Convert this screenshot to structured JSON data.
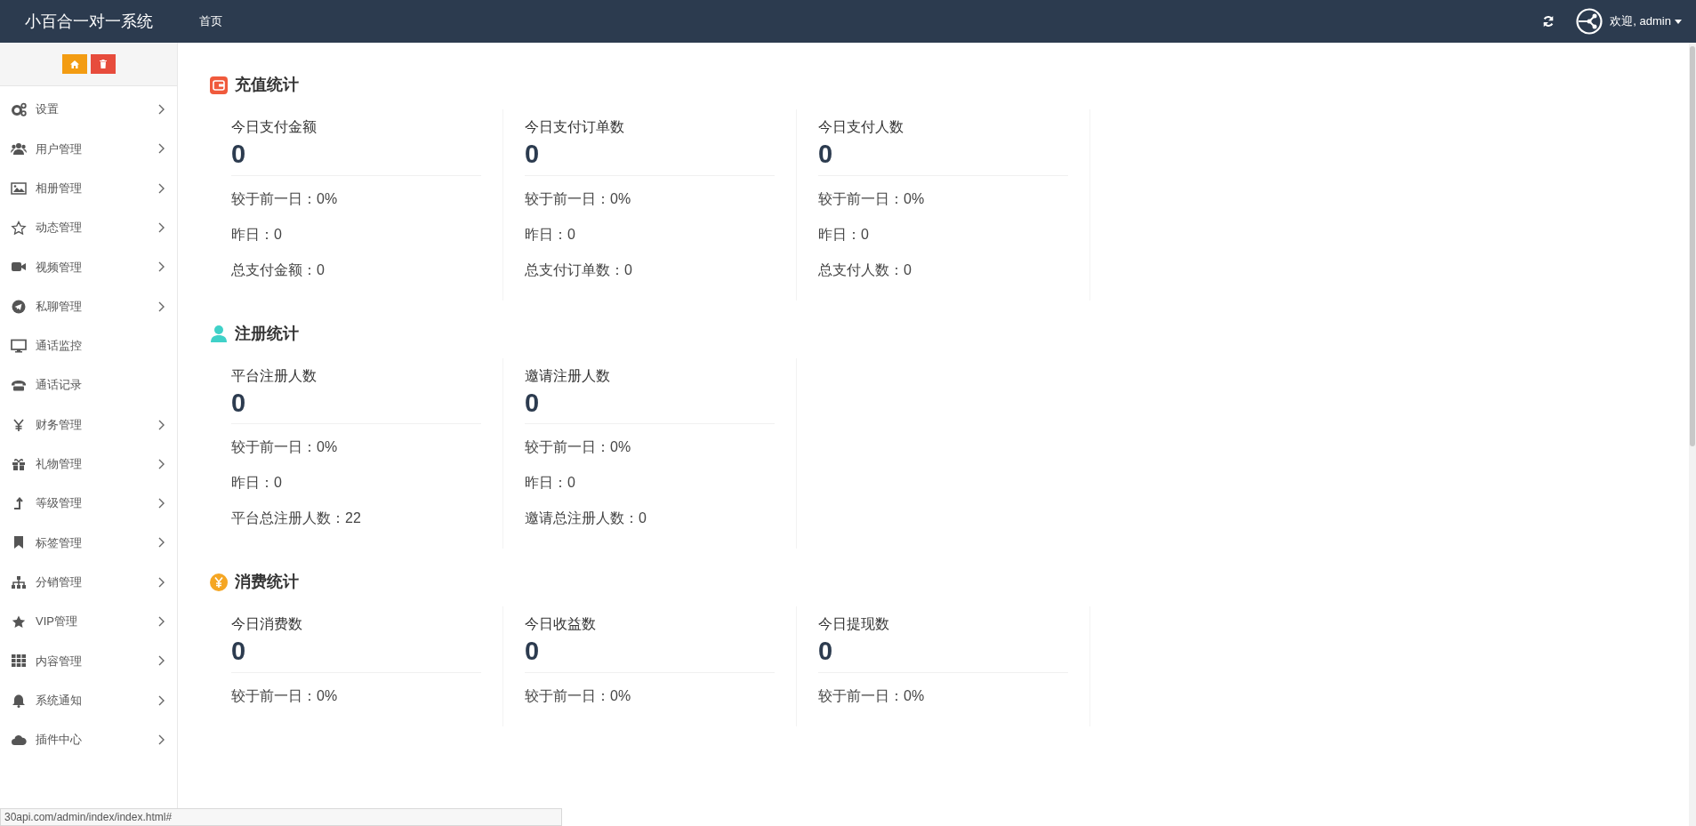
{
  "navbar": {
    "brand": "小百合一对一系统",
    "links": [
      "首页"
    ],
    "user": "欢迎, admin"
  },
  "sidebar": {
    "items": [
      {
        "label": "设置",
        "expandable": true
      },
      {
        "label": "用户管理",
        "expandable": true
      },
      {
        "label": "相册管理",
        "expandable": true
      },
      {
        "label": "动态管理",
        "expandable": true
      },
      {
        "label": "视频管理",
        "expandable": true
      },
      {
        "label": "私聊管理",
        "expandable": true
      },
      {
        "label": "通话监控",
        "expandable": false
      },
      {
        "label": "通话记录",
        "expandable": false
      },
      {
        "label": "财务管理",
        "expandable": true
      },
      {
        "label": "礼物管理",
        "expandable": true
      },
      {
        "label": "等级管理",
        "expandable": true
      },
      {
        "label": "标签管理",
        "expandable": true
      },
      {
        "label": "分销管理",
        "expandable": true
      },
      {
        "label": "VIP管理",
        "expandable": true
      },
      {
        "label": "内容管理",
        "expandable": true
      },
      {
        "label": "系统通知",
        "expandable": true
      },
      {
        "label": "插件中心",
        "expandable": true
      }
    ]
  },
  "sections": [
    {
      "title": "充值统计",
      "cards": [
        {
          "label": "今日支付金额",
          "value": "0",
          "lines": [
            "较于前一日：0%",
            "昨日：0",
            "总支付金额：0"
          ]
        },
        {
          "label": "今日支付订单数",
          "value": "0",
          "lines": [
            "较于前一日：0%",
            "昨日：0",
            "总支付订单数：0"
          ]
        },
        {
          "label": "今日支付人数",
          "value": "0",
          "lines": [
            "较于前一日：0%",
            "昨日：0",
            "总支付人数：0"
          ]
        }
      ]
    },
    {
      "title": "注册统计",
      "cards": [
        {
          "label": "平台注册人数",
          "value": "0",
          "lines": [
            "较于前一日：0%",
            "昨日：0",
            "平台总注册人数：22"
          ]
        },
        {
          "label": "邀请注册人数",
          "value": "0",
          "lines": [
            "较于前一日：0%",
            "昨日：0",
            "邀请总注册人数：0"
          ]
        }
      ]
    },
    {
      "title": "消费统计",
      "cards": [
        {
          "label": "今日消费数",
          "value": "0",
          "lines": [
            "较于前一日：0%"
          ]
        },
        {
          "label": "今日收益数",
          "value": "0",
          "lines": [
            "较于前一日：0%"
          ]
        },
        {
          "label": "今日提现数",
          "value": "0",
          "lines": [
            "较于前一日：0%"
          ]
        }
      ]
    }
  ],
  "status_url": "30api.com/admin/index/index.html#"
}
